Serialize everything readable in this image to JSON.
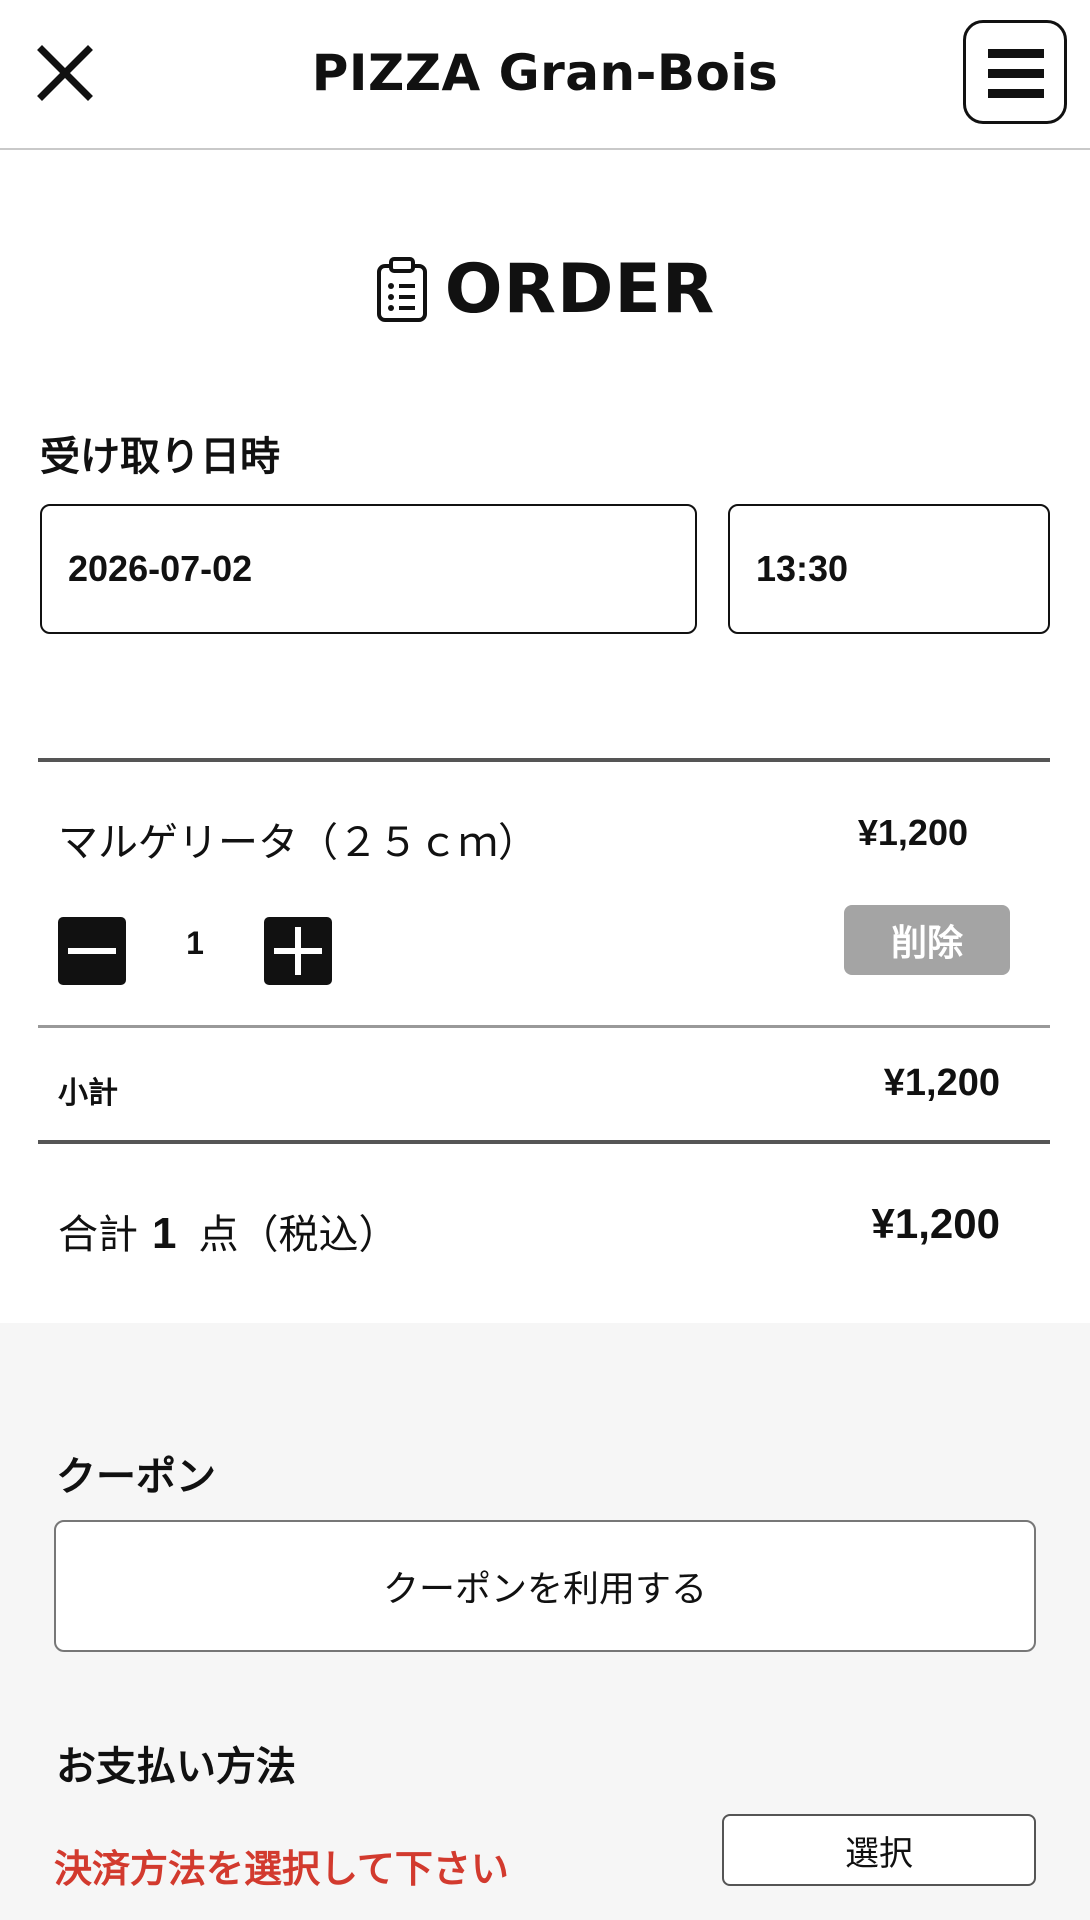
{
  "header": {
    "title": "PIZZA Gran-Bois"
  },
  "order": {
    "heading": "ORDER"
  },
  "pickup": {
    "label": "受け取り日時",
    "date": "2026-07-02",
    "time": "13:30"
  },
  "cart": {
    "items": [
      {
        "name": "マルゲリータ（２５ｃｍ）",
        "price": "¥1,200",
        "quantity": "1",
        "delete_label": "削除"
      }
    ],
    "subtotal_label": "小計",
    "subtotal_value": "¥1,200",
    "total_prefix": "合計",
    "total_count": "1",
    "total_suffix": "点（税込）",
    "total_value": "¥1,200"
  },
  "coupon": {
    "label": "クーポン",
    "button_label": "クーポンを利用する"
  },
  "payment": {
    "label": "お支払い方法",
    "warning": "決済方法を選択して下さい",
    "select_label": "選択"
  },
  "icons": {
    "close": "close-icon",
    "menu": "menu-icon",
    "order": "clipboard-list-icon",
    "minus": "minus-icon",
    "plus": "plus-icon"
  },
  "colors": {
    "warning": "#d23a2e",
    "delete_button": "#a4a4a4",
    "gray_section": "#f6f6f6"
  }
}
